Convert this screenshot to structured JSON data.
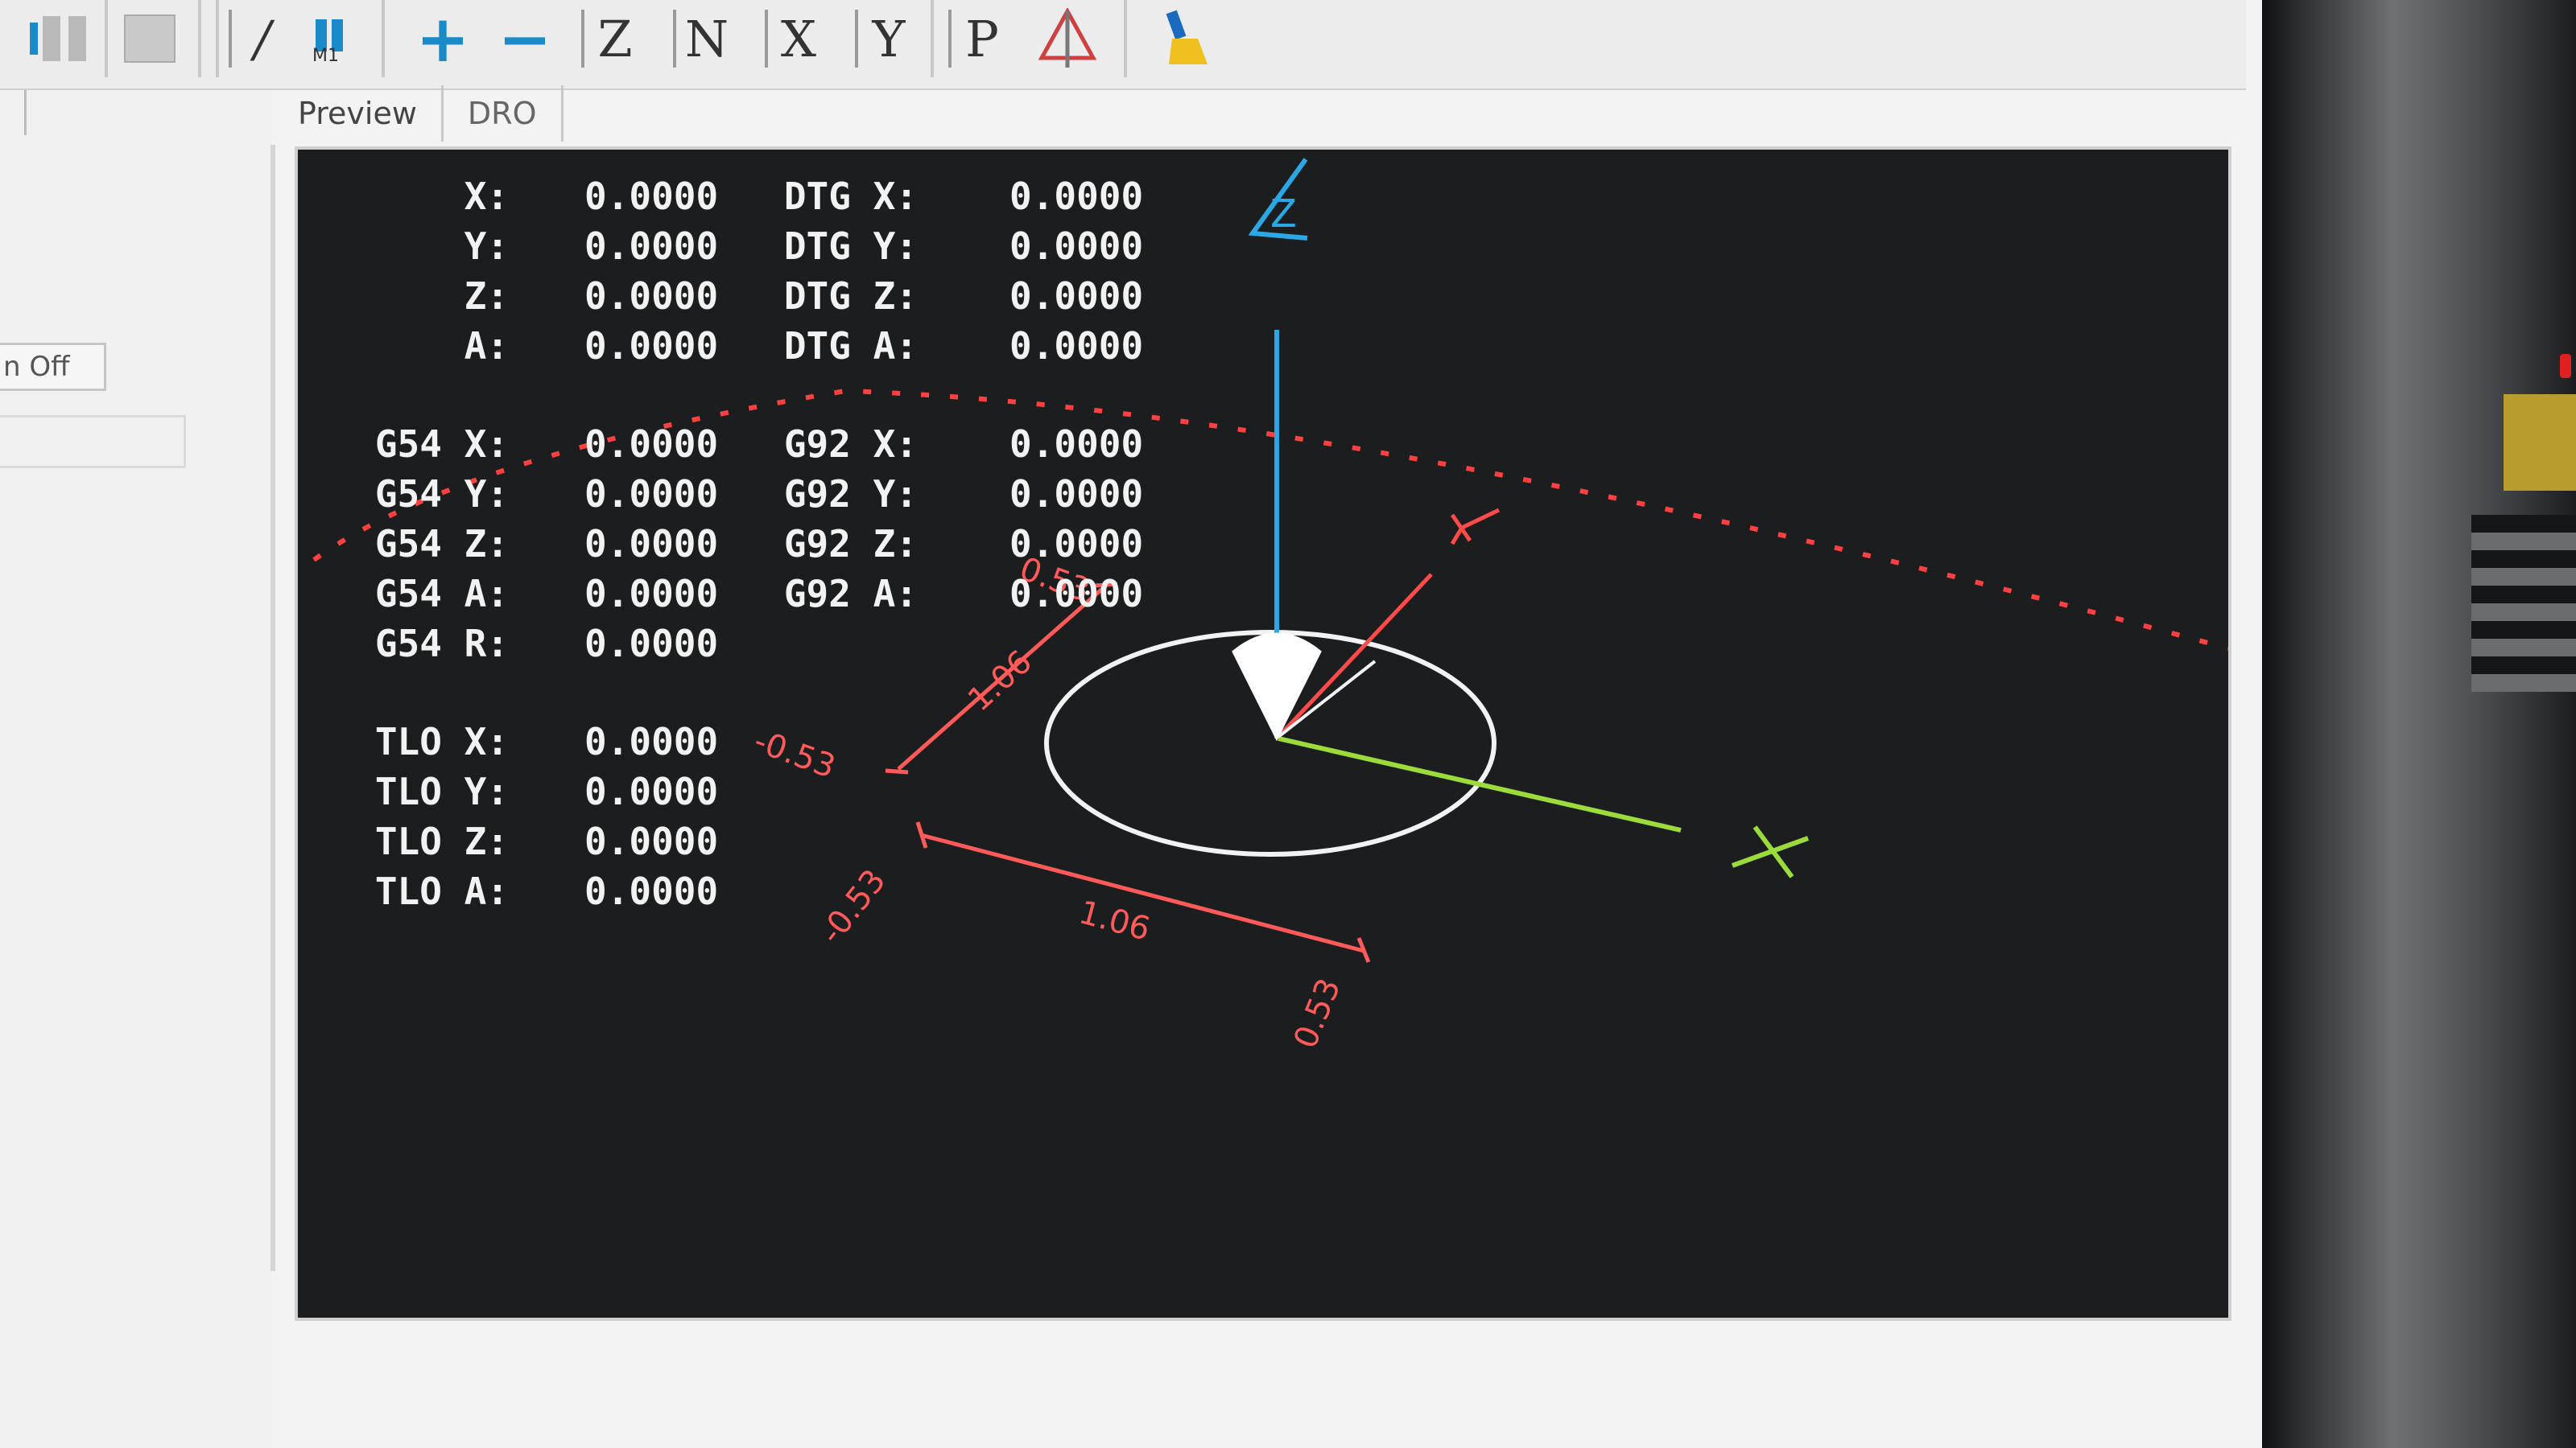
{
  "toolbar": {
    "tools": [
      {
        "name": "pause-icon"
      },
      {
        "name": "stop-icon"
      },
      {
        "name": "toggle-skip-lines-icon"
      },
      {
        "name": "optional-stop-icon"
      },
      {
        "name": "zoom-in-icon"
      },
      {
        "name": "zoom-out-icon"
      },
      {
        "name": "view-z-icon",
        "label": "Z"
      },
      {
        "name": "view-rotated-z-icon",
        "label": "N"
      },
      {
        "name": "view-x-icon",
        "label": "X"
      },
      {
        "name": "view-y-icon",
        "label": "Y"
      },
      {
        "name": "view-perspective-icon",
        "label": "P"
      },
      {
        "name": "rotate-view-icon"
      },
      {
        "name": "clear-plot-icon"
      }
    ]
  },
  "left_panel": {
    "flood_label": "n Off"
  },
  "tabs": [
    {
      "label": "Preview",
      "active": true
    },
    {
      "label": "DRO",
      "active": false
    }
  ],
  "dro": {
    "rows": [
      {
        "label": "X:",
        "value": "0.0000",
        "label2": "DTG X:",
        "value2": "0.0000"
      },
      {
        "label": "Y:",
        "value": "0.0000",
        "label2": "DTG Y:",
        "value2": "0.0000"
      },
      {
        "label": "Z:",
        "value": "0.0000",
        "label2": "DTG Z:",
        "value2": "0.0000"
      },
      {
        "label": "A:",
        "value": "0.0000",
        "label2": "DTG A:",
        "value2": "0.0000"
      },
      {
        "label": "G54 X:",
        "value": "0.0000",
        "label2": "G92 X:",
        "value2": "0.0000"
      },
      {
        "label": "G54 Y:",
        "value": "0.0000",
        "label2": "G92 Y:",
        "value2": "0.0000"
      },
      {
        "label": "G54 Z:",
        "value": "0.0000",
        "label2": "G92 Z:",
        "value2": "0.0000"
      },
      {
        "label": "G54 A:",
        "value": "0.0000",
        "label2": "G92 A:",
        "value2": "0.0000"
      },
      {
        "label": "G54 R:",
        "value": "0.0000"
      },
      {
        "label": "TLO X:",
        "value": "0.0000"
      },
      {
        "label": "TLO Y:",
        "value": "0.0000"
      },
      {
        "label": "TLO Z:",
        "value": "0.0000"
      },
      {
        "label": "TLO A:",
        "value": "0.0000"
      }
    ]
  },
  "preview": {
    "axes": {
      "x": "X",
      "y": "Y",
      "z": "Z"
    },
    "dimensions": {
      "x_length": "1.06",
      "x_min": "-0.53",
      "x_max": "0.53",
      "y_length": "1.06",
      "y_min": "-0.53",
      "y_max": "0.53"
    },
    "colors": {
      "x_axis": "#9bdc3a",
      "y_axis": "#ff4a4a",
      "z_axis": "#2aa8e6",
      "tool": "#ffffff",
      "background": "#1b1d1e",
      "limits": "#ff4040"
    }
  }
}
